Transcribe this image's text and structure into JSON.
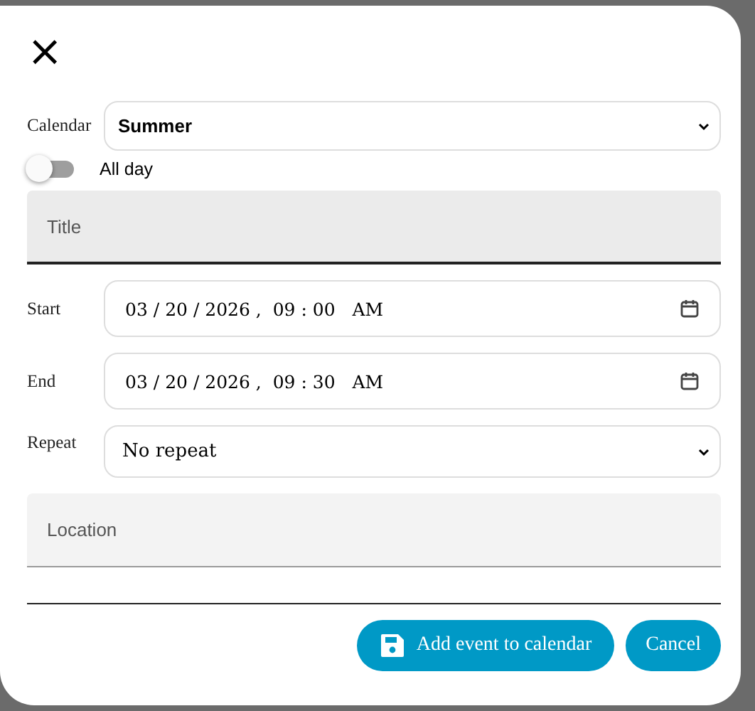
{
  "dialog": {
    "close": "×",
    "calendar": {
      "label": "Calendar",
      "value": "Summer"
    },
    "all_day": {
      "label": "All day",
      "on": false
    },
    "title_field": {
      "placeholder": "Title",
      "focused": true
    },
    "start": {
      "label": "Start",
      "value": "03 / 20 / 2026 ,  09 : 00   AM"
    },
    "end": {
      "label": "End",
      "value": "03 / 20 / 2026 ,  09 : 30   AM"
    },
    "repeat": {
      "label": "Repeat",
      "value": "No repeat"
    },
    "location_field": {
      "placeholder": "Location",
      "focused": false
    },
    "buttons": [
      {
        "label": "Add event to calendar",
        "kind": "save"
      },
      {
        "label": "Cancel",
        "kind": "plain"
      }
    ]
  }
}
